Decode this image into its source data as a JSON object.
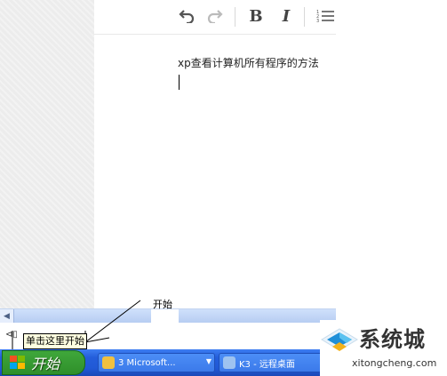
{
  "editor": {
    "toolbar": {
      "undo_icon": "undo-icon",
      "redo_icon": "redo-icon",
      "bold_label": "B",
      "italic_label": "I",
      "list_icon": "ordered-list-icon"
    },
    "content_line": "xp查看计算机所有程序的方法"
  },
  "annotation": {
    "label": "开始",
    "tooltip": "单击这里开始"
  },
  "taskbar": {
    "start_label": "开始",
    "tasks": [
      {
        "label": "3 Microsoft...",
        "icon": "outlook-icon"
      },
      {
        "label": "K3 - 远程桌面",
        "icon": "remote-desktop-icon"
      }
    ]
  },
  "watermark": {
    "title": "系统城",
    "url": "xitongcheng.com"
  },
  "colors": {
    "taskbar_blue": "#245edb",
    "start_green": "#3fa73b",
    "tooltip_bg": "#ffffe1",
    "scrollbar": "#d5e4fb"
  }
}
